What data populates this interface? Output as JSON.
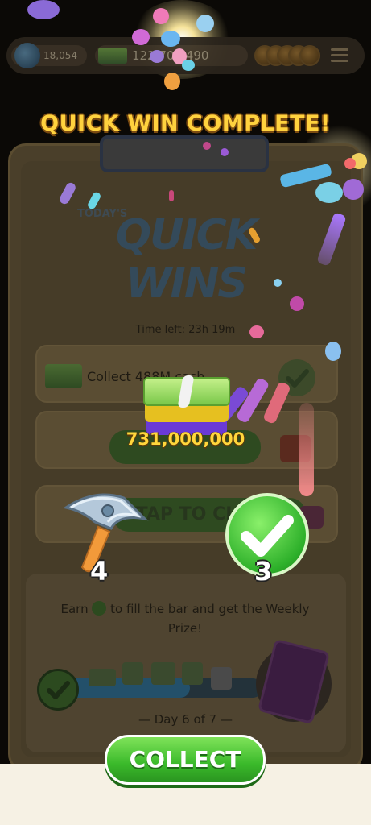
{
  "hud": {
    "gems": "18,054",
    "cash": "122,702,490"
  },
  "banner": "QUICK WIN COMPLETE!",
  "card": {
    "logo_small": "TODAY'S",
    "logo": "QUICK WINS",
    "time_left": "Time left: 23h 19m",
    "task1": "Collect 488M cash",
    "claim_label": "TAP TO CLAIM!",
    "earn_text_1": "Earn",
    "earn_text_2": "to fill the bar and get the Weekly Prize!",
    "day": "— Day 6 of 7 —"
  },
  "reward": {
    "cash_amount": "731,000,000",
    "hammer_count": "4",
    "check_count": "3"
  },
  "collect_label": "COLLECT",
  "colors": {
    "accent_green": "#3ab92a",
    "banner_yellow": "#ffd23e",
    "background": "#0b0906"
  },
  "icons": [
    "gem-icon",
    "cash-icon",
    "coin-icon",
    "menu-icon",
    "hammer-icon",
    "check-icon",
    "gift-icon",
    "prize-card-icon",
    "dice-icon"
  ]
}
